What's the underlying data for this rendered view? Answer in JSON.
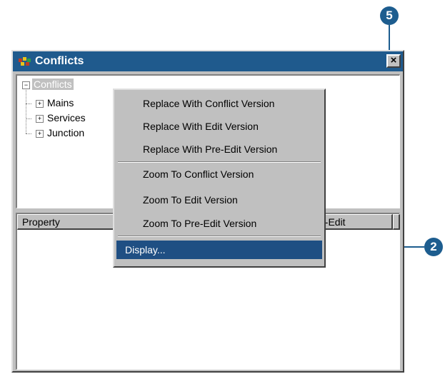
{
  "callouts": {
    "top": "5",
    "right": "2"
  },
  "window": {
    "title": "Conflicts",
    "close_glyph": "×"
  },
  "tree": {
    "root": "Conflicts",
    "children": [
      "Mains",
      "Services",
      "Junction"
    ],
    "expander_collapsed": "+",
    "expander_expanded": "−"
  },
  "table": {
    "headers": [
      "Property",
      "Pre-Edit"
    ]
  },
  "context_menu": {
    "items": [
      "Replace With Conflict Version",
      "Replace With Edit Version",
      "Replace With Pre-Edit Version",
      "Zoom To Conflict Version",
      "Zoom To Edit Version",
      "Zoom To Pre-Edit Version",
      "Display..."
    ],
    "selected": "Display..."
  },
  "colors": {
    "callout": "#1d5d8f",
    "titlebar": "#1f5a8d",
    "menu_selection": "#1f4f83",
    "face": "#c0c0c0"
  },
  "icons": {
    "app": "conflicts-app-icon",
    "close": "close-icon"
  }
}
